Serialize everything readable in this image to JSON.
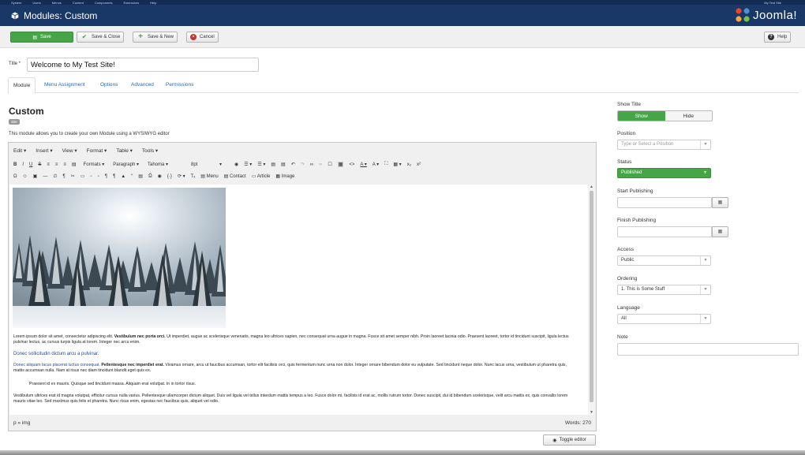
{
  "system_bar": {
    "items": [
      "System",
      "Users",
      "Menus",
      "Content",
      "Components",
      "Extensions",
      "Help"
    ],
    "right": "My Test Site",
    "text_legible": false
  },
  "header": {
    "title": "Modules: Custom",
    "brand": "Joomla!"
  },
  "toolbar": {
    "save": "Save",
    "save_close": "Save & Close",
    "save_new": "Save & New",
    "cancel": "Cancel",
    "help": "Help"
  },
  "title_field": {
    "label": "Title *",
    "value": "Welcome to My Test Site!"
  },
  "tabs": [
    "Module",
    "Menu Assignment",
    "Options",
    "Advanced",
    "Permissions"
  ],
  "module": {
    "heading": "Custom",
    "badge": "Site",
    "description": "This module allows you to create your own Module using a WYSIWYG editor"
  },
  "editor": {
    "menus": [
      "Edit ▾",
      "Insert ▾",
      "View ▾",
      "Format ▾",
      "Table ▾",
      "Tools ▾"
    ],
    "formats": "Formats ▾",
    "paragraph": "Paragraph",
    "font": "Tahoma",
    "size": "8pt",
    "menu_btn": "Menu",
    "contact_btn": "Contact",
    "article_btn": "Article",
    "image_btn": "Image",
    "path": "p » img",
    "words": "Words: 270",
    "toggle": "Toggle editor"
  },
  "body_text": {
    "p1a": "Lorem ipsum dolor sit amet, consectetur adipiscing elit.",
    "p1b": "Vestibulum nec porta orci.",
    "p1c": "Ut imperdiet, augue ac scelerisque venenatis, magna leo ultrices sapien, nec consequat urna augue in magna. Fusce sit amet semper nibh. Proin laoreet lacinia odio. Praesent laoreet, tortor id tincidunt suscipit, ligula lectus pulvinar lectus, ac cursus turpis ligula at lorem. Integer nec arcu enim.",
    "p2": "Donec sollicitudin dictum arcu a pulvinar.",
    "p3a": "Donec aliquam lacus placerat luctus consequat.",
    "p3b": "Pellentesque nec imperdiet erat.",
    "p3c": "Vivamus ornare, arcu ut faucibus accumsan, tortor elit facilisis orci, quis fermentum nunc urna non dolor. Integer ornare bibendum dolor eu vulputate. Sed tincidunt neque dolor. Nunc lacus urna, vestibulum ut pharetra quis, mattis accumsan nulla. Nam at risus nec diam tincidunt blandit eget quis ex.",
    "p4": "Praesent id ex mauris. Quisque sed tincidunt massa. Aliquam erat volutpat. In in tortor risus.",
    "p5": "Vestibulum ultrices erat id magna volutpat, efficitur cursus nulla varius. Pellentesque ullamcorper dictum aliquet. Duis vel ligula vel tellus interdum mattis tempus a leo. Fusce dolor mi, facilisis id erat ac, mollis rutrum tortor. Donec suscipit, dui id bibendum scelerisque, velit arcu mattis ex, quis convallis lorem mauris vitae leo. Sed maximus quis felis et pharetra. Nunc risus enim, egestas nec faucibus quis, aliquet vel odio."
  },
  "sidebar": {
    "show_title": {
      "label": "Show Title",
      "show": "Show",
      "hide": "Hide"
    },
    "position": {
      "label": "Position",
      "placeholder": "Type or Select a Position"
    },
    "status": {
      "label": "Status",
      "value": "Published"
    },
    "start_publishing": {
      "label": "Start Publishing"
    },
    "finish_publishing": {
      "label": "Finish Publishing"
    },
    "access": {
      "label": "Access",
      "value": "Public"
    },
    "ordering": {
      "label": "Ordering",
      "value": "1. This is Some Stuff"
    },
    "language": {
      "label": "Language",
      "value": "All"
    },
    "note": {
      "label": "Note"
    }
  },
  "colors": {
    "header": "#1a3867",
    "success": "#46a546",
    "link": "#2a69b8"
  }
}
